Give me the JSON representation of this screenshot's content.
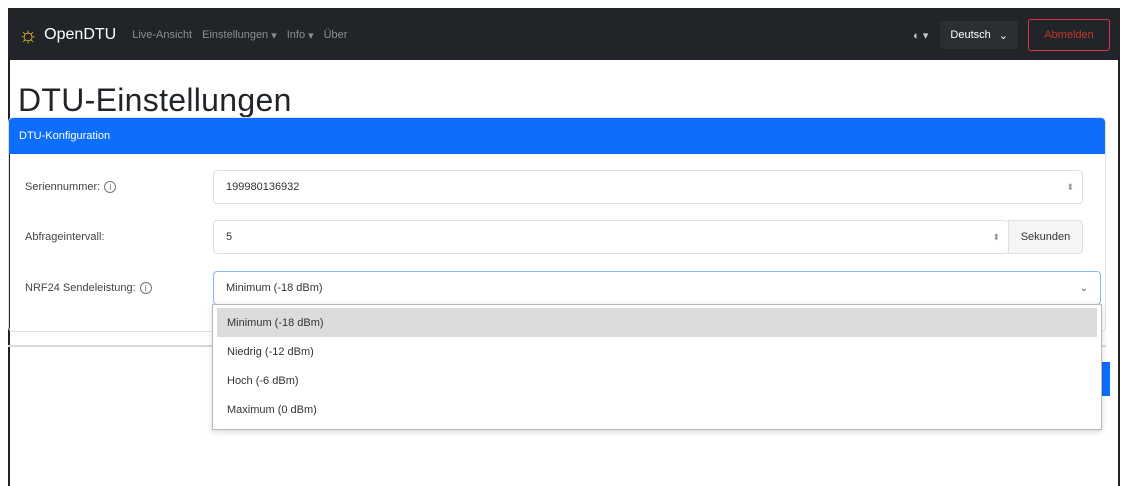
{
  "navbar": {
    "brand": "OpenDTU",
    "links": [
      {
        "label": "Live-Ansicht",
        "dropdown": false
      },
      {
        "label": "Einstellungen",
        "dropdown": true
      },
      {
        "label": "Info",
        "dropdown": true
      },
      {
        "label": "Über",
        "dropdown": false
      }
    ],
    "theme_icon": "◐",
    "language": "Deutsch",
    "logout": "Abmelden"
  },
  "page": {
    "title": "DTU-Einstellungen"
  },
  "card": {
    "header": "DTU-Konfiguration",
    "serial": {
      "label": "Seriennummer:",
      "value": "199980136932"
    },
    "interval": {
      "label": "Abfrageintervall:",
      "value": "5",
      "unit": "Sekunden"
    },
    "power": {
      "label": "NRF24 Sendeleistung:",
      "value": "Minimum (-18 dBm)"
    }
  },
  "dropdown": {
    "options": [
      "Minimum (-18 dBm)",
      "Niedrig (-12 dBm)",
      "Hoch (-6 dBm)",
      "Maximum (0 dBm)"
    ],
    "selected_index": 0
  },
  "colors": {
    "primary": "#0d6efd",
    "navbar": "#212529",
    "danger": "#dc3545",
    "brand_sun": "#f5c518"
  }
}
